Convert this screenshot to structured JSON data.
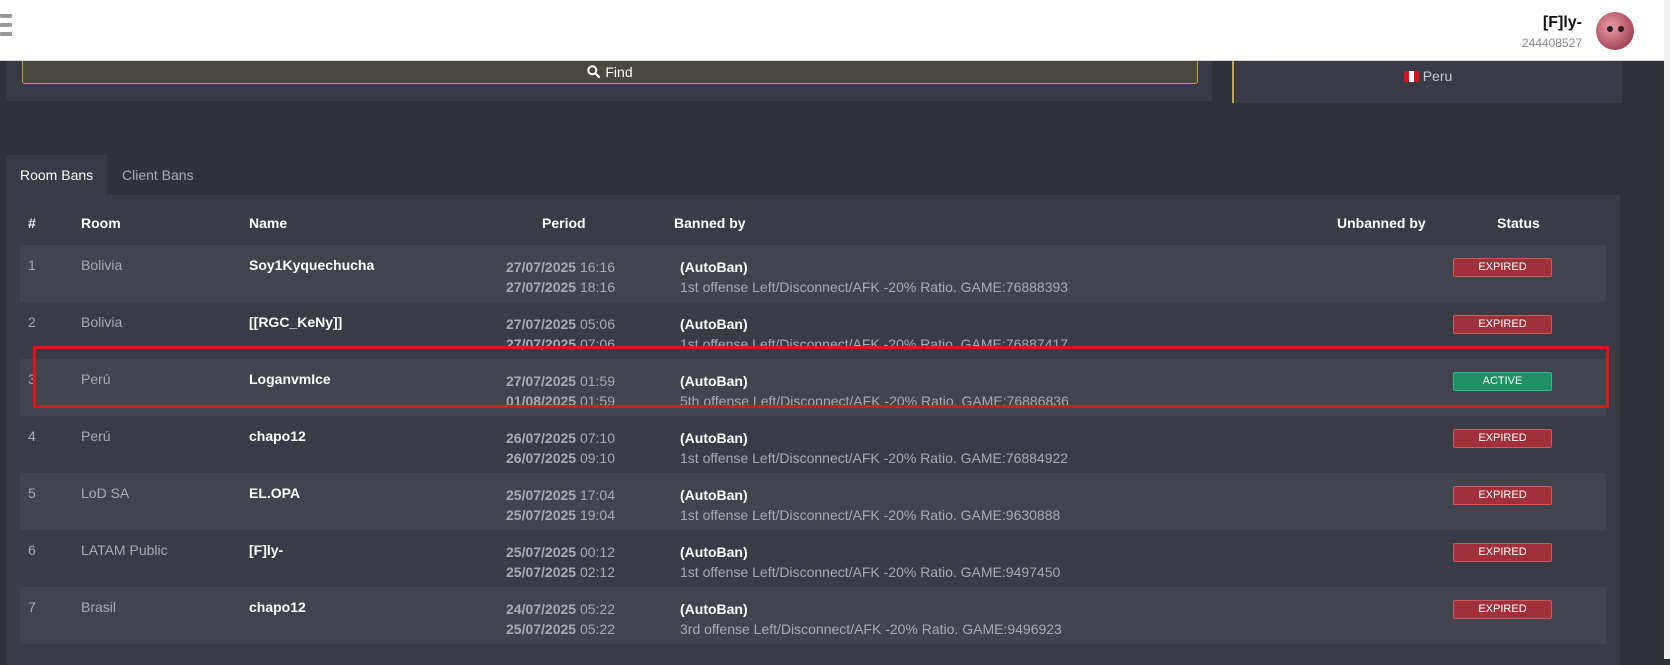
{
  "header": {
    "user_name": "[F]ly-",
    "user_id": "244408527",
    "menu_icon": "hamburger-menu-icon",
    "avatar_icon": "user-avatar"
  },
  "search": {
    "find_label": "Find",
    "find_icon": "search-icon"
  },
  "region": {
    "country": "Peru",
    "flag_icon": "peru-flag-icon"
  },
  "tabs": [
    {
      "label": "Room Bans",
      "active": true
    },
    {
      "label": "Client Bans",
      "active": false
    }
  ],
  "table": {
    "columns": {
      "num": "#",
      "room": "Room",
      "name": "Name",
      "period": "Period",
      "banned_by": "Banned by",
      "unbanned_by": "Unbanned by",
      "status": "Status"
    },
    "rows": [
      {
        "num": "1",
        "room": "Bolivia",
        "name": "Soy1Kyquechucha",
        "start_date": "27/07/2025",
        "start_time": "16:16",
        "end_date": "27/07/2025",
        "end_time": "18:16",
        "banned_by": "(AutoBan)",
        "reason": "1st offense Left/Disconnect/AFK -20% Ratio. GAME:76888393",
        "unbanned_by": "",
        "status": "EXPIRED"
      },
      {
        "num": "2",
        "room": "Bolivia",
        "name": "[[RGC_KeNy]]",
        "start_date": "27/07/2025",
        "start_time": "05:06",
        "end_date": "27/07/2025",
        "end_time": "07:06",
        "banned_by": "(AutoBan)",
        "reason": "1st offense Left/Disconnect/AFK -20% Ratio. GAME:76887417",
        "unbanned_by": "",
        "status": "EXPIRED"
      },
      {
        "num": "3",
        "room": "Perú",
        "name": "LoganvmIce",
        "start_date": "27/07/2025",
        "start_time": "01:59",
        "end_date": "01/08/2025",
        "end_time": "01:59",
        "banned_by": "(AutoBan)",
        "reason": "5th offense Left/Disconnect/AFK -20% Ratio. GAME:76886836",
        "unbanned_by": "",
        "status": "ACTIVE"
      },
      {
        "num": "4",
        "room": "Perú",
        "name": "chapo12",
        "start_date": "26/07/2025",
        "start_time": "07:10",
        "end_date": "26/07/2025",
        "end_time": "09:10",
        "banned_by": "(AutoBan)",
        "reason": "1st offense Left/Disconnect/AFK -20% Ratio. GAME:76884922",
        "unbanned_by": "",
        "status": "EXPIRED"
      },
      {
        "num": "5",
        "room": "LoD SA",
        "name": "EL.OPA",
        "start_date": "25/07/2025",
        "start_time": "17:04",
        "end_date": "25/07/2025",
        "end_time": "19:04",
        "banned_by": "(AutoBan)",
        "reason": "1st offense Left/Disconnect/AFK -20% Ratio. GAME:9630888",
        "unbanned_by": "",
        "status": "EXPIRED"
      },
      {
        "num": "6",
        "room": "LATAM Public",
        "name": "[F]ly-",
        "start_date": "25/07/2025",
        "start_time": "00:12",
        "end_date": "25/07/2025",
        "end_time": "02:12",
        "banned_by": "(AutoBan)",
        "reason": "1st offense Left/Disconnect/AFK -20% Ratio. GAME:9497450",
        "unbanned_by": "",
        "status": "EXPIRED"
      },
      {
        "num": "7",
        "room": "Brasil",
        "name": "chapo12",
        "start_date": "24/07/2025",
        "start_time": "05:22",
        "end_date": "25/07/2025",
        "end_time": "05:22",
        "banned_by": "(AutoBan)",
        "reason": "3rd offense Left/Disconnect/AFK -20% Ratio. GAME:9496923",
        "unbanned_by": "",
        "status": "EXPIRED"
      }
    ]
  },
  "colors": {
    "accent": "#c8a13a",
    "expired": "#a1303a",
    "active": "#1f8f66",
    "highlight": "#e2141b"
  }
}
